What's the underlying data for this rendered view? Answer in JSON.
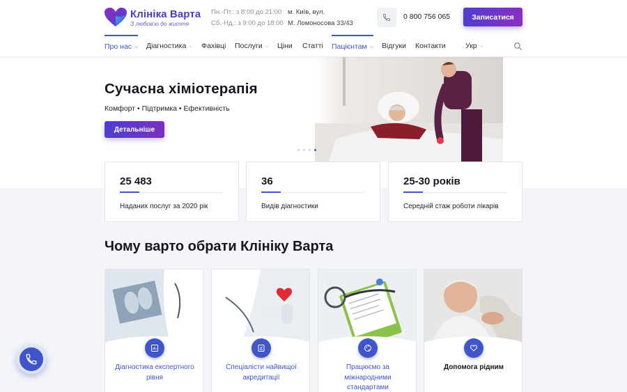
{
  "header": {
    "logo_name": "Клініка Варта",
    "logo_tagline": "З любов'ю до життя",
    "hours": [
      "Пн.-Пт.: з 8:00 до 21:00",
      "Сб.-Нд.: з 9:00 до 18:00"
    ],
    "address": [
      "м. Київ, вул.",
      "М. Ломоносова 33/43"
    ],
    "phone_icon": "phone-icon",
    "phone": "0 800 756 065",
    "cta_label": "Записатися"
  },
  "nav": {
    "items": [
      {
        "label": "Про нас",
        "dropdown": true,
        "active": true
      },
      {
        "label": "Діагностика",
        "dropdown": true
      },
      {
        "label": "Фахівці",
        "dropdown": false
      },
      {
        "label": "Послуги",
        "dropdown": true
      },
      {
        "label": "Ціни",
        "dropdown": false
      },
      {
        "label": "Статті",
        "dropdown": false
      },
      {
        "label": "Пацієнтам",
        "dropdown": true,
        "active": true
      },
      {
        "label": "Відгуки",
        "dropdown": false
      },
      {
        "label": "Контакти",
        "dropdown": false
      },
      {
        "label": "Укр",
        "dropdown": true
      }
    ],
    "search_icon": "search-icon"
  },
  "hero": {
    "title": "Сучасна хіміотерапія",
    "subtitle": "Комфорт • Підтримка • Ефективність",
    "button_label": "Детальніше",
    "slides_total": 4,
    "slide_active": 4
  },
  "stats": [
    {
      "value": "25 483",
      "label": "Наданих послуг за 2020 рік"
    },
    {
      "value": "36",
      "label": "Видів діагностики"
    },
    {
      "value": "25-30 років",
      "label": "Середній стаж роботи лікарів"
    }
  ],
  "why": {
    "title": "Чому варто обрати Клініку Варта",
    "cards": [
      {
        "label": "Діагностика експертного рівня",
        "icon": "chart-icon"
      },
      {
        "label": "Спеціалісти найвищої акредитації",
        "icon": "certificate-icon"
      },
      {
        "label": "Працюємо за міжнародними стандартами",
        "icon": "globe-icon"
      },
      {
        "label": "Допомога рідним",
        "icon": "heart-icon"
      }
    ]
  },
  "fab_icon": "phone-icon",
  "colors": {
    "accent": "#3f55c9",
    "brand_gradient_start": "#4d3fd1",
    "brand_gradient_end": "#8a2fbf",
    "section_bg": "#f4f5f9"
  }
}
